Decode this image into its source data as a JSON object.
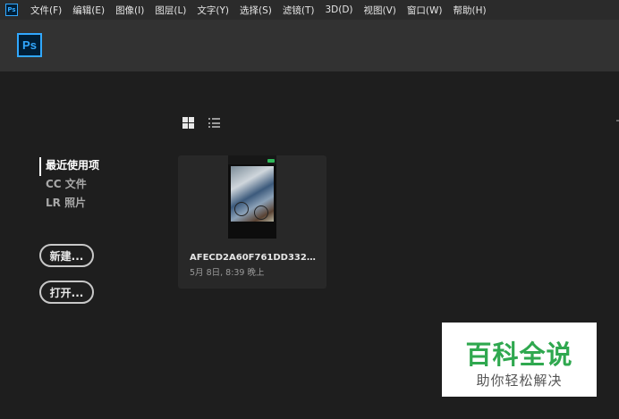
{
  "menubar": {
    "app_icon": "Ps",
    "items": [
      {
        "label": "文件(F)"
      },
      {
        "label": "编辑(E)"
      },
      {
        "label": "图像(I)"
      },
      {
        "label": "图层(L)"
      },
      {
        "label": "文字(Y)"
      },
      {
        "label": "选择(S)"
      },
      {
        "label": "滤镜(T)"
      },
      {
        "label": "3D(D)"
      },
      {
        "label": "视图(V)"
      },
      {
        "label": "窗口(W)"
      },
      {
        "label": "帮助(H)"
      }
    ]
  },
  "header": {
    "logo_text": "Ps"
  },
  "view_toggles": {
    "grid_icon": "grid-view-icon",
    "list_icon": "list-view-icon"
  },
  "side_nav": {
    "items": [
      {
        "label": "最近使用项",
        "active": true
      },
      {
        "label": "CC 文件",
        "active": false
      },
      {
        "label": "LR 照片",
        "active": false
      }
    ]
  },
  "buttons": {
    "new_label": "新建...",
    "open_label": "打开..."
  },
  "recent": {
    "files": [
      {
        "name": "AFECD2A60F761DD332FC1...",
        "date": "5月 8日, 8:39 晚上"
      }
    ]
  },
  "watermark": {
    "title": "百科全说",
    "subtitle": "助你轻松解决"
  },
  "colors": {
    "ps_blue": "#31a8ff",
    "ps_dark": "#001e36",
    "bg": "#1e1e1e",
    "header": "#323232",
    "watermark_green": "#2fa84f"
  }
}
